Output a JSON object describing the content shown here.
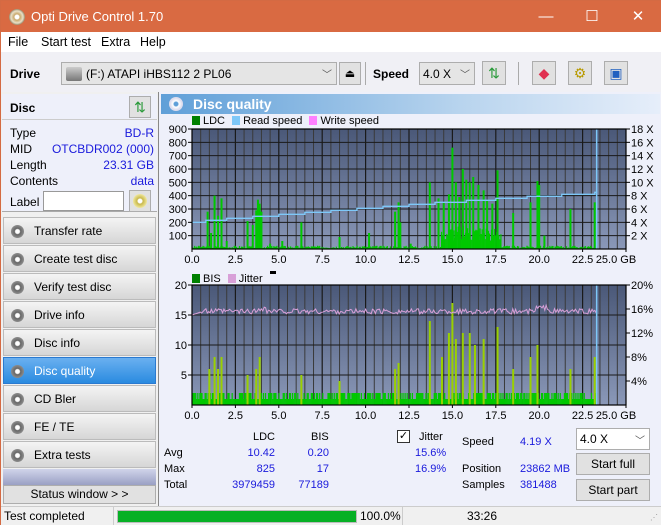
{
  "window": {
    "title": "Opti Drive Control 1.70",
    "minimize": "—",
    "maximize": "☐",
    "close": "✕"
  },
  "menu": [
    "File",
    "Start test",
    "Extra",
    "Help"
  ],
  "toolbar": {
    "drive_label": "Drive",
    "drive_value": "(F:)  ATAPI iHBS112  2 PL06",
    "speed_label": "Speed",
    "speed_value": "4.0 X",
    "icons": [
      "eject-icon",
      "refresh-icon",
      "eraser-icon",
      "settings-icon",
      "save-icon"
    ]
  },
  "disc": {
    "header": "Disc",
    "rows": [
      {
        "key": "Type",
        "value": "BD-R"
      },
      {
        "key": "MID",
        "value": "OTCBDR002 (000)"
      },
      {
        "key": "Length",
        "value": "23.31 GB"
      },
      {
        "key": "Contents",
        "value": "data"
      }
    ],
    "label_key": "Label",
    "label_value": ""
  },
  "nav": [
    {
      "label": "Transfer rate",
      "active": false
    },
    {
      "label": "Create test disc",
      "active": false
    },
    {
      "label": "Verify test disc",
      "active": false
    },
    {
      "label": "Drive info",
      "active": false
    },
    {
      "label": "Disc info",
      "active": false
    },
    {
      "label": "Disc quality",
      "active": true
    },
    {
      "label": "CD Bler",
      "active": false
    },
    {
      "label": "FE / TE",
      "active": false
    },
    {
      "label": "Extra tests",
      "active": false
    }
  ],
  "status_window_label": "Status window > >",
  "panel_title": "Disc quality",
  "colors": {
    "ldc": "#00c800",
    "bis": "#00c800",
    "read_speed": "#7ec8f8",
    "write_speed": "#ff80ff",
    "jitter": "#d8a0d8",
    "plot_top": "#4a5878",
    "plot_bottom": "#8a98b8",
    "accent": "#2a8be0",
    "progress": "#06b025"
  },
  "chart_data": [
    {
      "type": "bar",
      "title": "LDC / Read speed",
      "legend": [
        "LDC",
        "Read speed",
        "Write speed"
      ],
      "xlabel": "GB",
      "x_ticks": [
        "0.0",
        "2.5",
        "5.0",
        "7.5",
        "10.0",
        "12.5",
        "15.0",
        "17.5",
        "20.0",
        "22.5",
        "25.0 GB"
      ],
      "xlim": [
        0,
        25
      ],
      "y_ticks_left": [
        "100",
        "200",
        "300",
        "400",
        "500",
        "600",
        "700",
        "800",
        "900"
      ],
      "ylim_left": [
        0,
        900
      ],
      "y_ticks_right": [
        "2 X",
        "4 X",
        "6 X",
        "8 X",
        "10 X",
        "12 X",
        "14 X",
        "16 X",
        "18 X"
      ],
      "ylim_right": [
        0,
        18
      ],
      "end_marker_gb": 23.31,
      "ldc_peaks": [
        [
          0.4,
          20
        ],
        [
          0.9,
          280
        ],
        [
          1.1,
          120
        ],
        [
          1.3,
          400
        ],
        [
          1.5,
          250
        ],
        [
          1.7,
          380
        ],
        [
          2.0,
          60
        ],
        [
          3.2,
          210
        ],
        [
          3.5,
          180
        ],
        [
          3.7,
          290
        ],
        [
          3.8,
          370
        ],
        [
          3.9,
          340
        ],
        [
          4.0,
          280
        ],
        [
          4.5,
          40
        ],
        [
          5.2,
          60
        ],
        [
          6.3,
          200
        ],
        [
          8.5,
          90
        ],
        [
          10.2,
          120
        ],
        [
          11.7,
          280
        ],
        [
          11.9,
          350
        ],
        [
          12.0,
          200
        ],
        [
          12.6,
          40
        ],
        [
          13.7,
          500
        ],
        [
          14.2,
          380
        ],
        [
          14.5,
          350
        ],
        [
          14.8,
          410
        ],
        [
          15.0,
          760
        ],
        [
          15.2,
          500
        ],
        [
          15.4,
          390
        ],
        [
          15.6,
          600
        ],
        [
          15.8,
          520
        ],
        [
          16.0,
          500
        ],
        [
          16.2,
          540
        ],
        [
          16.5,
          480
        ],
        [
          16.8,
          440
        ],
        [
          17.0,
          370
        ],
        [
          17.3,
          340
        ],
        [
          17.6,
          590
        ],
        [
          18.5,
          270
        ],
        [
          19.5,
          350
        ],
        [
          19.9,
          510
        ],
        [
          20.0,
          480
        ],
        [
          20.3,
          100
        ],
        [
          21.8,
          300
        ],
        [
          23.2,
          350
        ]
      ],
      "read_speed_steps": [
        [
          0,
          4.0
        ],
        [
          0.8,
          4.3
        ],
        [
          2.0,
          4.6
        ],
        [
          3.5,
          4.9
        ],
        [
          5.0,
          5.2
        ],
        [
          6.5,
          5.5
        ],
        [
          8.0,
          5.8
        ],
        [
          9.5,
          6.1
        ],
        [
          11.0,
          6.4
        ],
        [
          12.5,
          6.7
        ],
        [
          14.0,
          7.0
        ],
        [
          15.8,
          7.3
        ],
        [
          17.5,
          7.6
        ],
        [
          19.3,
          7.9
        ],
        [
          21.3,
          8.2
        ],
        [
          23.2,
          8.5
        ]
      ]
    },
    {
      "type": "bar",
      "title": "BIS / Jitter",
      "legend": [
        "BIS",
        "Jitter"
      ],
      "xlabel": "GB",
      "x_ticks": [
        "0.0",
        "2.5",
        "5.0",
        "7.5",
        "10.0",
        "12.5",
        "15.0",
        "17.5",
        "20.0",
        "22.5",
        "25.0 GB"
      ],
      "xlim": [
        0,
        25
      ],
      "y_ticks_left": [
        "5",
        "10",
        "15",
        "20"
      ],
      "ylim_left": [
        0,
        20
      ],
      "y_ticks_right": [
        "4%",
        "8%",
        "12%",
        "16%",
        "20%"
      ],
      "ylim_right": [
        0,
        20
      ],
      "end_marker_gb": 23.31,
      "bis_peaks": [
        [
          1.0,
          6
        ],
        [
          1.3,
          8
        ],
        [
          1.5,
          6
        ],
        [
          1.7,
          8
        ],
        [
          3.2,
          5
        ],
        [
          3.7,
          6
        ],
        [
          3.9,
          8
        ],
        [
          6.3,
          5
        ],
        [
          8.5,
          4
        ],
        [
          11.7,
          6
        ],
        [
          11.9,
          7
        ],
        [
          13.7,
          14
        ],
        [
          14.4,
          8
        ],
        [
          14.8,
          12
        ],
        [
          15.0,
          17
        ],
        [
          15.2,
          11
        ],
        [
          15.6,
          12
        ],
        [
          16.0,
          12
        ],
        [
          16.3,
          10
        ],
        [
          16.8,
          11
        ],
        [
          17.6,
          13
        ],
        [
          18.5,
          6
        ],
        [
          19.5,
          8
        ],
        [
          19.9,
          10
        ],
        [
          21.8,
          6
        ],
        [
          23.2,
          8
        ]
      ],
      "jitter_avg_pct": 15.6,
      "jitter_max_pct": 16.9
    }
  ],
  "stats": {
    "col_ldc": "LDC",
    "col_bis": "BIS",
    "jitter_label": "Jitter",
    "jitter_checked": true,
    "rows": [
      {
        "label": "Avg",
        "ldc": "10.42",
        "bis": "0.20",
        "jitter": "15.6%"
      },
      {
        "label": "Max",
        "ldc": "825",
        "bis": "17",
        "jitter": "16.9%"
      },
      {
        "label": "Total",
        "ldc": "3979459",
        "bis": "77189",
        "jitter": ""
      }
    ],
    "speed_label": "Speed",
    "speed_value": "4.19 X",
    "position_label": "Position",
    "position_value": "23862 MB",
    "samples_label": "Samples",
    "samples_value": "381488",
    "speed_select": "4.0 X",
    "start_full": "Start full",
    "start_part": "Start part"
  },
  "statusbar": {
    "text": "Test completed",
    "progress_pct": 100,
    "progress_text": "100.0%",
    "time": "33:26"
  }
}
